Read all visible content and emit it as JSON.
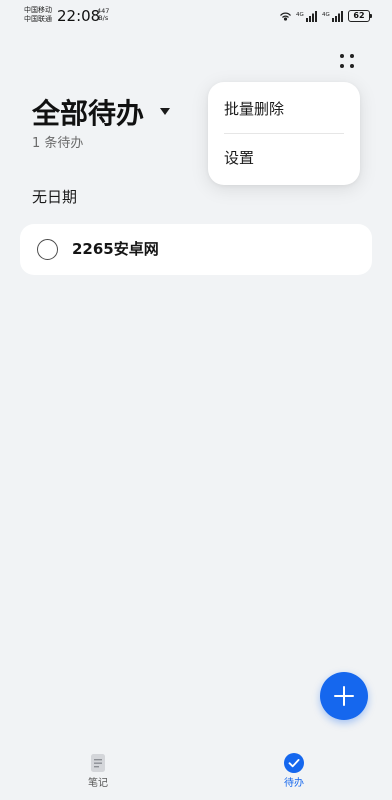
{
  "status_bar": {
    "carrier_1": "中国移动",
    "carrier_2": "中国联通",
    "time": "22:08",
    "net_speed_value": "447",
    "net_speed_unit": "B/s",
    "battery": "62"
  },
  "header": {
    "title": "全部待办",
    "count_text": "1 条待办"
  },
  "sections": [
    {
      "header": "无日期",
      "items": [
        {
          "text": "2265安卓网",
          "checked": false
        }
      ]
    }
  ],
  "overflow_menu": {
    "items": [
      {
        "label": "批量删除"
      },
      {
        "label": "设置"
      }
    ]
  },
  "bottom_nav": {
    "items": [
      {
        "label": "笔记",
        "icon": "note-icon",
        "active": false
      },
      {
        "label": "待办",
        "icon": "check-circle-icon",
        "active": true
      }
    ]
  },
  "fab": {
    "icon": "plus-icon"
  },
  "colors": {
    "background": "#f1f3f5",
    "accent": "#1567ee",
    "card": "#ffffff"
  }
}
